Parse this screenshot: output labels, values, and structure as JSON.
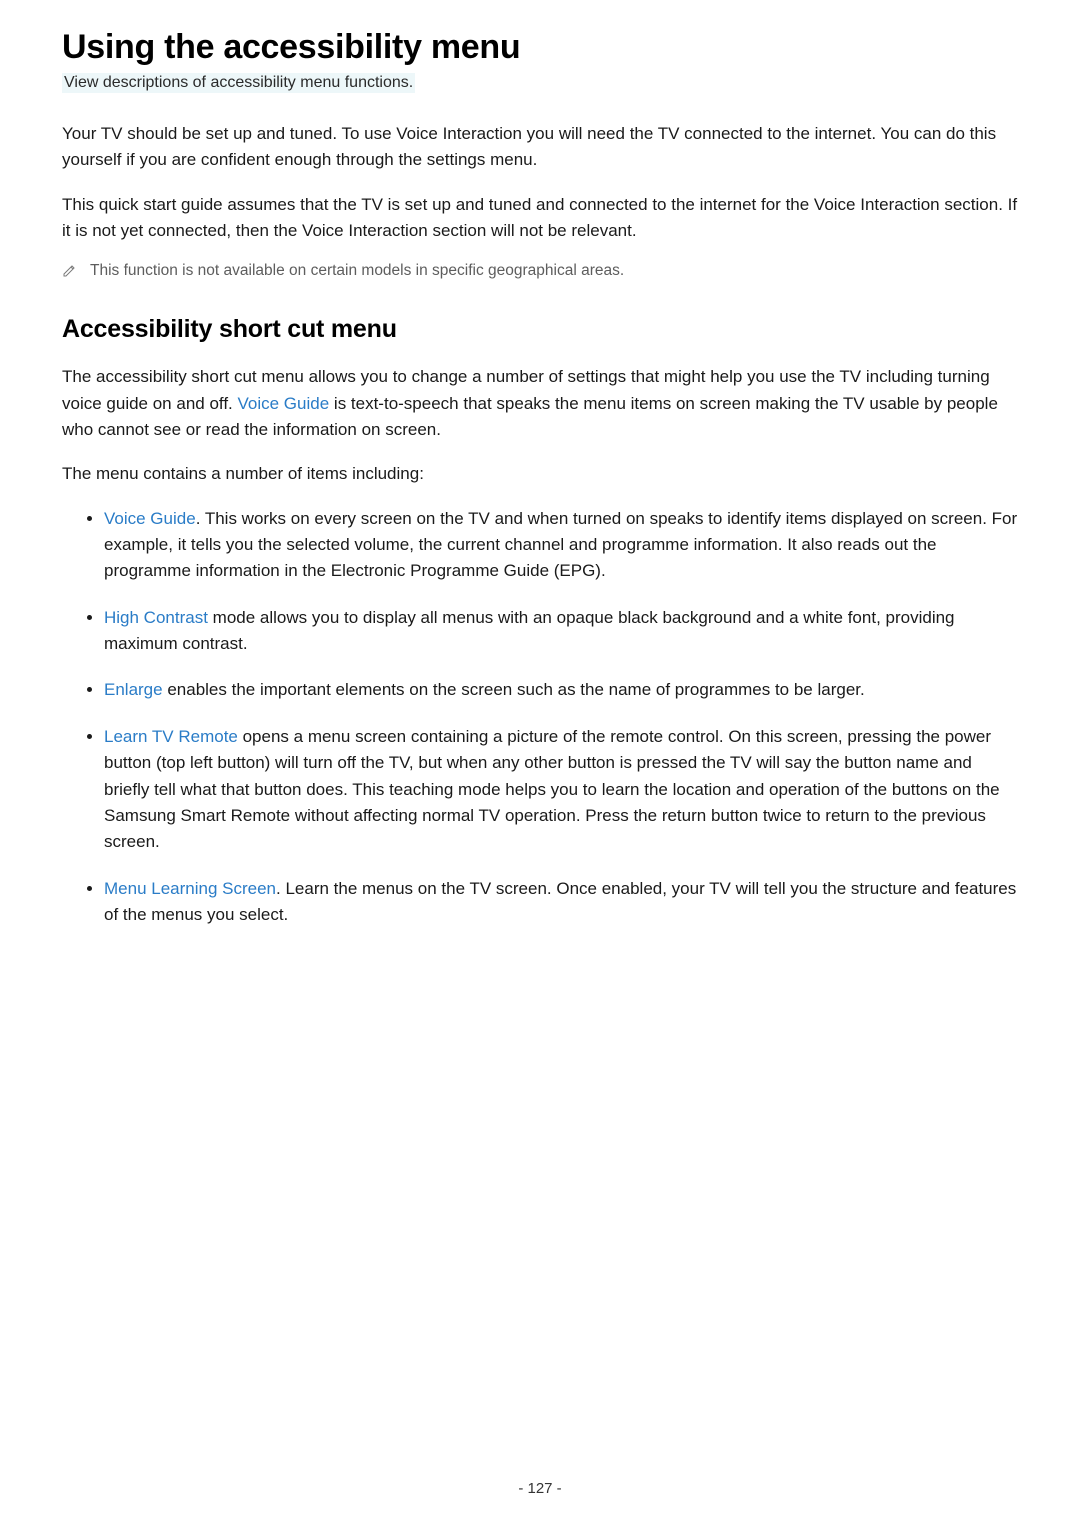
{
  "heading": "Using the accessibility menu",
  "subtitle": "View descriptions of accessibility menu functions.",
  "para1": "Your TV should be set up and tuned. To use Voice Interaction you will need the TV connected to the internet. You can do this yourself if you are confident enough through the settings menu.",
  "para2": "This quick start guide assumes that the TV is set up and tuned and connected to the internet for the Voice Interaction section. If it is not yet connected, then the Voice Interaction section will not be relevant.",
  "note": "This function is not available on certain models in specific geographical areas.",
  "section_heading": "Accessibility short cut menu",
  "section_para_pre": "The accessibility short cut menu allows you to change a number of settings that might help you use the TV including turning voice guide on and off. ",
  "section_para_feature": "Voice Guide",
  "section_para_post": " is text-to-speech that speaks the menu items on screen making the TV usable by people who cannot see or read the information on screen.",
  "lead_in": "The menu contains a number of items including:",
  "items": [
    {
      "feature": "Voice Guide",
      "text": ". This works on every screen on the TV and when turned on speaks to identify items displayed on screen. For example, it tells you the selected volume, the current channel and programme information. It also reads out the programme information in the Electronic Programme Guide (EPG)."
    },
    {
      "feature": "High Contrast",
      "text": " mode allows you to display all menus with an opaque black background and a white font, providing maximum contrast."
    },
    {
      "feature": "Enlarge",
      "text": " enables the important elements on the screen such as the name of programmes to be larger."
    },
    {
      "feature": "Learn TV Remote",
      "text": " opens a menu screen containing a picture of the remote control. On this screen, pressing the power button (top left button) will turn off the TV, but when any other button is pressed the TV will say the button name and briefly tell what that button does. This teaching mode helps you to learn the location and operation of the buttons on the Samsung Smart Remote without affecting normal TV operation. Press the return button twice to return to the previous screen."
    },
    {
      "feature": "Menu Learning Screen",
      "text": ". Learn the menus on the TV screen. Once enabled, your TV will tell you the structure and features of the menus you select."
    }
  ],
  "page_number": "- 127 -"
}
